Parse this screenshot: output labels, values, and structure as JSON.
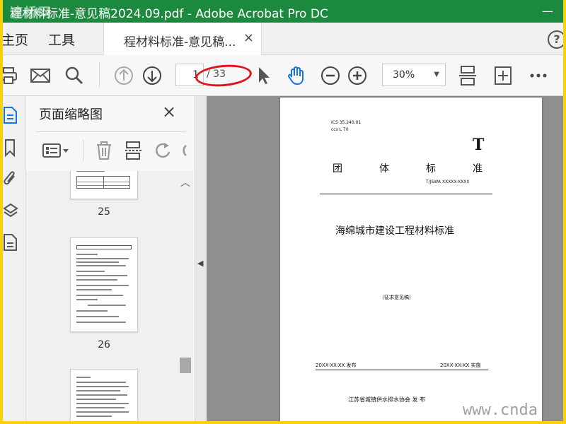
{
  "app": {
    "window_title": "程材料标准-意见稿2024.09.pdf - Adobe Acrobat Pro DC",
    "watermark_logo": "速桥网",
    "colors": {
      "titlebar": "#1c8a3e",
      "frame": "#f5d20c",
      "annotation": "#e0141a",
      "accent_blue": "#1473e6"
    }
  },
  "window_controls": {
    "minimize": "—"
  },
  "tabs": {
    "home": "主页",
    "tools": "工具",
    "document": "程材料标准-意见稿...",
    "close": "×",
    "help": "?"
  },
  "toolbar": {
    "icons": [
      "print-icon",
      "mail-icon",
      "search-icon",
      "prev-page-icon",
      "next-page-icon",
      "select-cursor-icon",
      "hand-tool-icon",
      "zoom-out-icon",
      "zoom-in-icon",
      "fit-width-icon",
      "fit-page-icon",
      "more-icon"
    ],
    "current_page": "1",
    "total_pages": "/ 33",
    "zoom": "30%"
  },
  "panel": {
    "title": "页面缩略图",
    "close": "×",
    "thumbnails": [
      {
        "page_label": "25"
      },
      {
        "page_label": "26"
      }
    ]
  },
  "page": {
    "ics": "ICS 35.240.01",
    "ccs": "ccs  L 70",
    "big_t": "T",
    "group_std": [
      "团",
      "体",
      "标",
      "准"
    ],
    "std_no": "T/JSWA  XXXXX-XXXX",
    "doc_title": "海绵城市建设工程材料标准",
    "draft": "（征求意见稿）",
    "publish": "20XX-XX-XX 发布",
    "implement": "20XX-XX-XX 实施",
    "issuer": "江苏省城镇供水排水协会    发  布"
  },
  "footer_watermark": "www.cnda"
}
